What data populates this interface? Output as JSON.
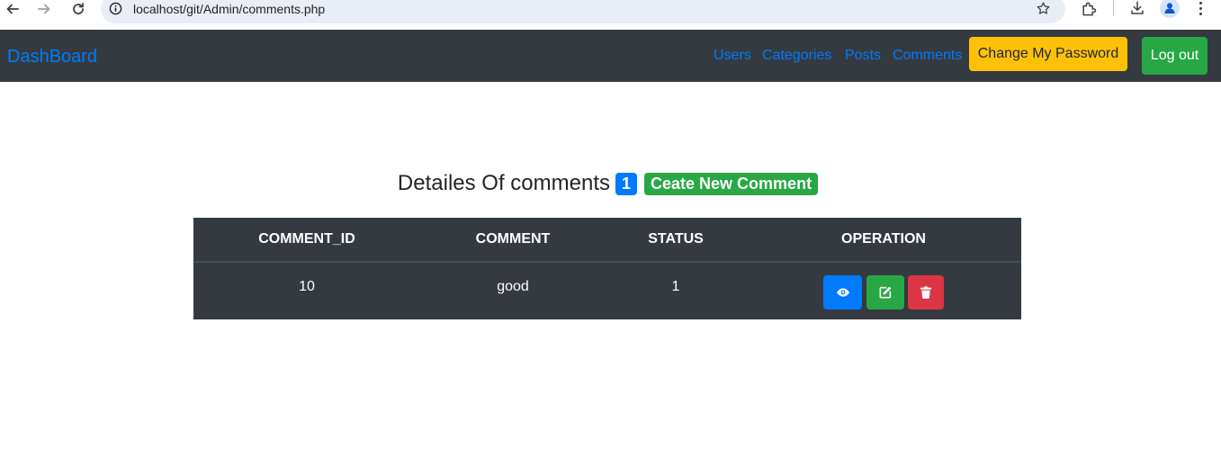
{
  "browser": {
    "url": "localhost/git/Admin/comments.php"
  },
  "navbar": {
    "brand": "DashBoard",
    "links": [
      "Users",
      "Categories",
      "Posts",
      "Comments"
    ],
    "change_password_label": "Change My Password",
    "logout_label": "Log out"
  },
  "heading": {
    "title": "Detailes Of comments",
    "count": "1",
    "create_label": "Ceate New Comment"
  },
  "table": {
    "columns": [
      "COMMENT_ID",
      "COMMENT",
      "STATUS",
      "OPERATION"
    ],
    "rows": [
      {
        "comment_id": "10",
        "comment": "good",
        "status": "1"
      }
    ]
  },
  "icons": {
    "view": "eye-icon",
    "edit": "edit-icon",
    "delete": "trash-icon"
  },
  "colors": {
    "navbar_bg": "#343a40",
    "link": "#007bff",
    "warning": "#ffc107",
    "success": "#28a745",
    "danger": "#dc3545",
    "primary": "#007bff"
  }
}
